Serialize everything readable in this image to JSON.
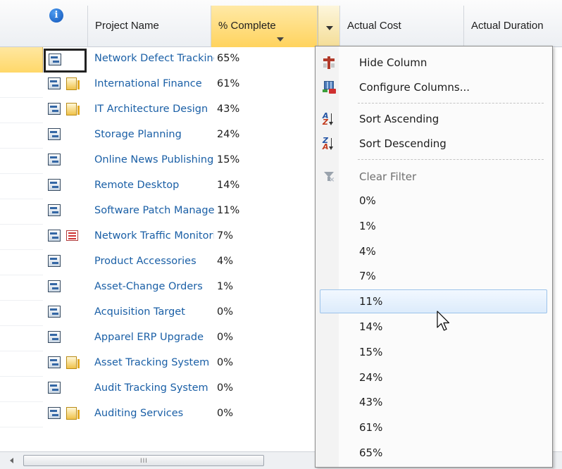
{
  "header": {
    "columns": [
      {
        "key": "info",
        "label": ""
      },
      {
        "key": "project_name",
        "label": "Project Name"
      },
      {
        "key": "pct_complete",
        "label": "% Complete"
      },
      {
        "key": "actual_cost",
        "label": "Actual Cost"
      },
      {
        "key": "actual_duration",
        "label": "Actual Duration"
      }
    ],
    "info_glyph": "i"
  },
  "rows": [
    {
      "name": "Network Defect Tracking",
      "pct": "65%",
      "extra_icon": null,
      "selected": true
    },
    {
      "name": "International Finance",
      "pct": "61%",
      "extra_icon": "document-icon",
      "selected": false
    },
    {
      "name": "IT Architecture Design",
      "pct": "43%",
      "extra_icon": "document-icon",
      "selected": false
    },
    {
      "name": "Storage Planning",
      "pct": "24%",
      "extra_icon": null,
      "selected": false
    },
    {
      "name": "Online News Publishing",
      "pct": "15%",
      "extra_icon": null,
      "selected": false
    },
    {
      "name": "Remote Desktop",
      "pct": "14%",
      "extra_icon": null,
      "selected": false
    },
    {
      "name": "Software Patch Management",
      "pct": "11%",
      "extra_icon": null,
      "selected": false
    },
    {
      "name": "Network Traffic Monitoring",
      "pct": "7%",
      "extra_icon": "list-icon",
      "selected": false
    },
    {
      "name": "Product Accessories",
      "pct": "4%",
      "extra_icon": null,
      "selected": false
    },
    {
      "name": "Asset-Change Orders",
      "pct": "1%",
      "extra_icon": null,
      "selected": false
    },
    {
      "name": "Acquisition Target",
      "pct": "0%",
      "extra_icon": null,
      "selected": false
    },
    {
      "name": "Apparel ERP Upgrade",
      "pct": "0%",
      "extra_icon": null,
      "selected": false
    },
    {
      "name": "Asset Tracking System",
      "pct": "0%",
      "extra_icon": "document-icon",
      "selected": false
    },
    {
      "name": "Audit Tracking System",
      "pct": "0%",
      "extra_icon": null,
      "selected": false
    },
    {
      "name": "Auditing Services",
      "pct": "0%",
      "extra_icon": "document-icon",
      "selected": false
    }
  ],
  "menu": {
    "actions": [
      {
        "label": "Hide Column",
        "icon": "hide-column-icon"
      },
      {
        "label": "Configure Columns...",
        "icon": "configure-columns-icon"
      },
      {
        "label": "Sort Ascending",
        "icon": "sort-ascending-icon"
      },
      {
        "label": "Sort Descending",
        "icon": "sort-descending-icon"
      },
      {
        "label": "Clear Filter",
        "icon": "clear-filter-icon",
        "disabled": true
      }
    ],
    "filter_values": [
      "0%",
      "1%",
      "4%",
      "7%",
      "11%",
      "14%",
      "15%",
      "24%",
      "43%",
      "61%",
      "65%"
    ],
    "hovered_value": "11%"
  },
  "scrollbar": {
    "grip": "III"
  },
  "colors": {
    "link": "#1a5fa6",
    "selection": "#ffd35e",
    "menu_hover": "#dcebfb"
  }
}
